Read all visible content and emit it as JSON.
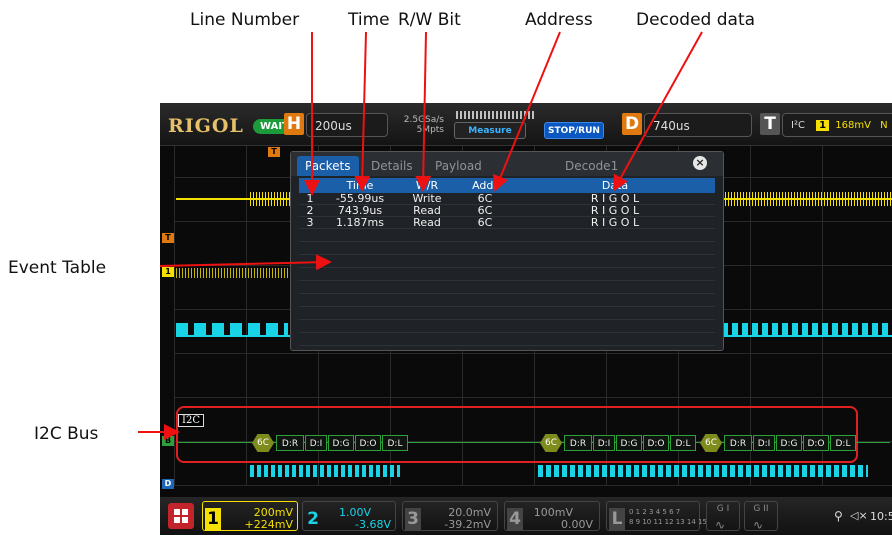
{
  "annotations": {
    "line_number": "Line Number",
    "time": "Time",
    "rw_bit": "R/W Bit",
    "address": "Address",
    "decoded_data": "Decoded data",
    "event_table": "Event Table",
    "i2c_bus": "I2C Bus"
  },
  "topbar": {
    "brand": "RIGOL",
    "status": "WAIT",
    "h_label": "H",
    "h_value": "200us",
    "sample_rate": "2.5GSa/s",
    "memory_depth": "5Mpts",
    "measure": "Measure",
    "stop_run": "STOP/RUN",
    "d_label": "D",
    "d_value": "740us",
    "t_label": "T",
    "trigger_type": "I²C",
    "trigger_source": "1",
    "trigger_level": "168mV",
    "trigger_mode": "N"
  },
  "markers": {
    "trig_pos": "T",
    "ch1_trig": "T",
    "ch1_marker": "1",
    "i2c_label": "I2C",
    "bus_marker": "B",
    "d_marker": "D"
  },
  "decode_panel": {
    "tabs": [
      "Packets",
      "Details",
      "Payload"
    ],
    "title": "Decode1",
    "close": "×",
    "headers": [
      "",
      "Time",
      "W/R",
      "Addr",
      "Data"
    ],
    "rows": [
      {
        "line": "1",
        "time": "-55.99us",
        "wr": "Write",
        "addr": "6C",
        "data": "R I G O L"
      },
      {
        "line": "2",
        "time": "743.9us",
        "wr": "Read",
        "addr": "6C",
        "data": "R I G O L"
      },
      {
        "line": "3",
        "time": "1.187ms",
        "wr": "Read",
        "addr": "6C",
        "data": "R I G O L"
      }
    ]
  },
  "bus": {
    "address": "6C",
    "bytes": [
      "D:R",
      "D:I",
      "D:G",
      "D:O",
      "D:L"
    ]
  },
  "channels": [
    {
      "num": "1",
      "scale": "200mV",
      "offset": "+224mV",
      "color": "#f5e000"
    },
    {
      "num": "2",
      "scale": "1.00V",
      "offset": "-3.68V",
      "color": "#19d3e6"
    },
    {
      "num": "3",
      "scale": "20.0mV",
      "offset": "-39.2mV",
      "color": "#777777"
    },
    {
      "num": "4",
      "scale": "100mV",
      "offset": "0.00V",
      "color": "#777777"
    }
  ],
  "bottombar": {
    "la_label": "L",
    "la_digits1": "0 1 2 3  4 5 6 7",
    "la_digits2": "8 9 10 11 12 13 14 15",
    "g1": "G I",
    "g2": "G II",
    "usb_icon": "usb-icon",
    "speaker_icon": "speaker-icon",
    "clock": "10:5"
  }
}
